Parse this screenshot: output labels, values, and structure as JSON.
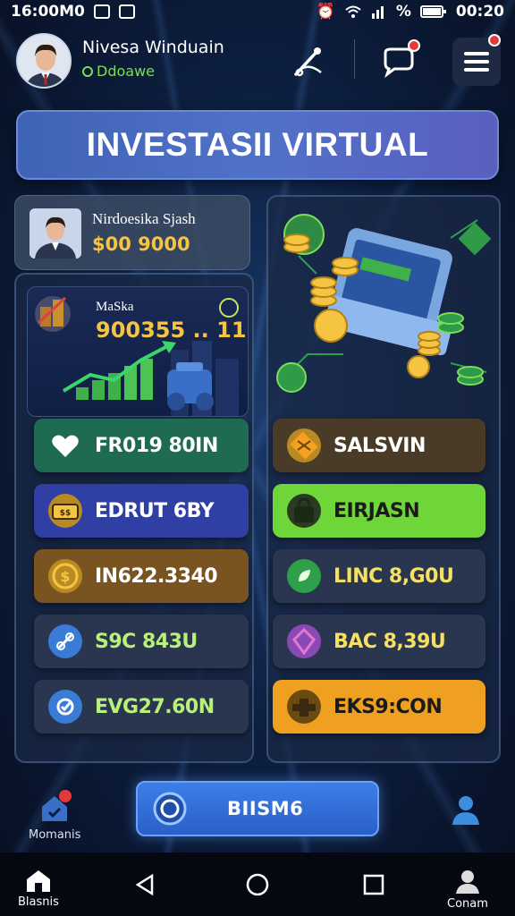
{
  "status_bar": {
    "time_left": "16:00M0",
    "battery_pct": "%",
    "time_right": "00:20"
  },
  "header": {
    "user_name": "Nivesa Winduain",
    "user_status": "Ddoawe",
    "action_icon": "fishing-rod-icon",
    "chat_icon": "chat-bubble-icon",
    "menu_icon": "hamburger-menu-icon"
  },
  "banner": {
    "title": "INVESTASII VIRTUAL"
  },
  "account": {
    "label": "Nirdoesika Sjash",
    "balance": "$00 9000"
  },
  "chart_card": {
    "label": "MaSka",
    "value": "900355 .. 11"
  },
  "left_buttons": [
    {
      "label": "FR019 80IN",
      "icon": "heart-icon",
      "bg": "#1f6a52",
      "icon_bg": "#1f6a52"
    },
    {
      "label": "EDRUT 6BY",
      "icon": "ticket-icon",
      "bg": "#2f3fa3",
      "icon_bg": "#b98a23"
    },
    {
      "label": "IN622.3340",
      "icon": "coin-icon",
      "bg": "#7a5420",
      "icon_bg": "#b98a23"
    },
    {
      "label": "S9C 843U",
      "icon": "link-icon",
      "bg": "#2a3550",
      "icon_bg": "#3a7bd5"
    },
    {
      "label": "EVG27.60N",
      "icon": "check-badge-icon",
      "bg": "#2a3550",
      "icon_bg": "#3a7bd5"
    }
  ],
  "right_buttons": [
    {
      "label": "SALSVIN",
      "icon": "crate-icon",
      "bg": "#4a3a28",
      "icon_bg": "#b98a23"
    },
    {
      "label": "EIRJASN",
      "icon": "bag-icon",
      "bg": "#6fd63a",
      "icon_bg": "#2a3a20"
    },
    {
      "label": "LINC 8,G0U",
      "icon": "leaf-icon",
      "bg": "#2a3550",
      "icon_bg": "#2fa04a"
    },
    {
      "label": "BAC 8,39U",
      "icon": "diamond-icon",
      "bg": "#2a3550",
      "icon_bg": "#8a4ab5"
    },
    {
      "label": "EKS9:CON",
      "icon": "puzzle-icon",
      "bg": "#f0a020",
      "icon_bg": "#6b4a10"
    }
  ],
  "bottom": {
    "left_label": "Momanis",
    "action_label": "BIISM6",
    "profile_icon": "user-icon"
  },
  "navbar": {
    "home_label": "Blasnis",
    "user_label": "Conam"
  }
}
